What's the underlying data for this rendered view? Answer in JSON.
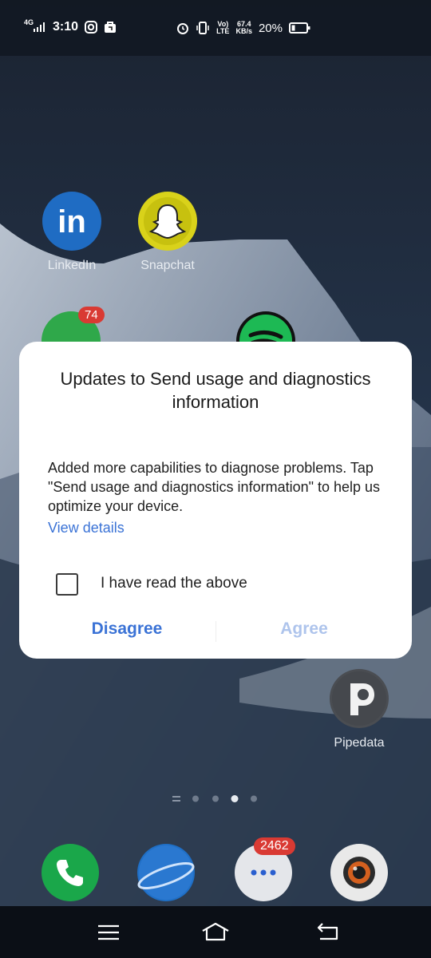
{
  "status_bar": {
    "network": "4G",
    "time": "3:10",
    "volte_top": "Vo)",
    "volte_bottom": "LTE",
    "speed_value": "67.4",
    "speed_unit": "KB/s",
    "battery": "20%"
  },
  "home_apps": [
    {
      "label": "LinkedIn",
      "icon": "linkedin-icon"
    },
    {
      "label": "Snapchat",
      "icon": "snapchat-icon"
    },
    {
      "label": "Pipedata",
      "icon": "pipedata-icon"
    }
  ],
  "whatsapp_badge": "74",
  "dialog": {
    "title": "Updates to Send usage and diagnostics information",
    "body": "Added more capabilities to diagnose problems. Tap \"Send usage and diagnostics information\" to help us optimize your device.",
    "link": "View details",
    "checkbox_label": "I have read the above",
    "checkbox_checked": false,
    "disagree": "Disagree",
    "agree": "Agree"
  },
  "dock": {
    "messages_badge": "2462",
    "apps": [
      "phone-icon",
      "browser-icon",
      "messages-icon",
      "camera-icon"
    ]
  },
  "colors": {
    "link_blue": "#3b73d6",
    "agree_disabled": "#aec4ec",
    "badge_red": "#d93a33"
  }
}
